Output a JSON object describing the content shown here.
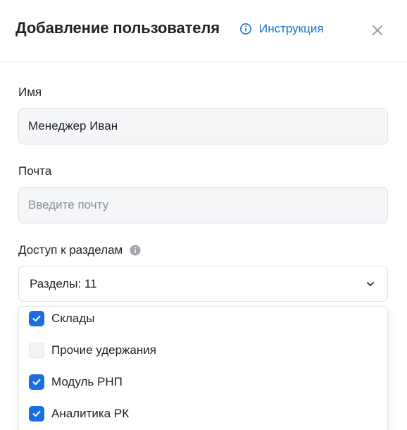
{
  "modal": {
    "title": "Добавление пользователя",
    "help_link_label": "Инструкция",
    "close_icon": "close-icon"
  },
  "form": {
    "name": {
      "label": "Имя",
      "value": "Менеджер Иван"
    },
    "email": {
      "label": "Почта",
      "placeholder": "Введите почту"
    },
    "access": {
      "label": "Доступ к разделам",
      "select_value": "Разделы: 11",
      "options": [
        {
          "label": "Склады",
          "checked": true
        },
        {
          "label": "Прочие удержания",
          "checked": false
        },
        {
          "label": "Модуль РНП",
          "checked": true
        },
        {
          "label": "Аналитика РК",
          "checked": true
        }
      ]
    }
  },
  "colors": {
    "accent": "#1a6fe0",
    "link": "#1a73d9",
    "input_bg": "#f5f6f8",
    "border": "#dfe2e7"
  }
}
